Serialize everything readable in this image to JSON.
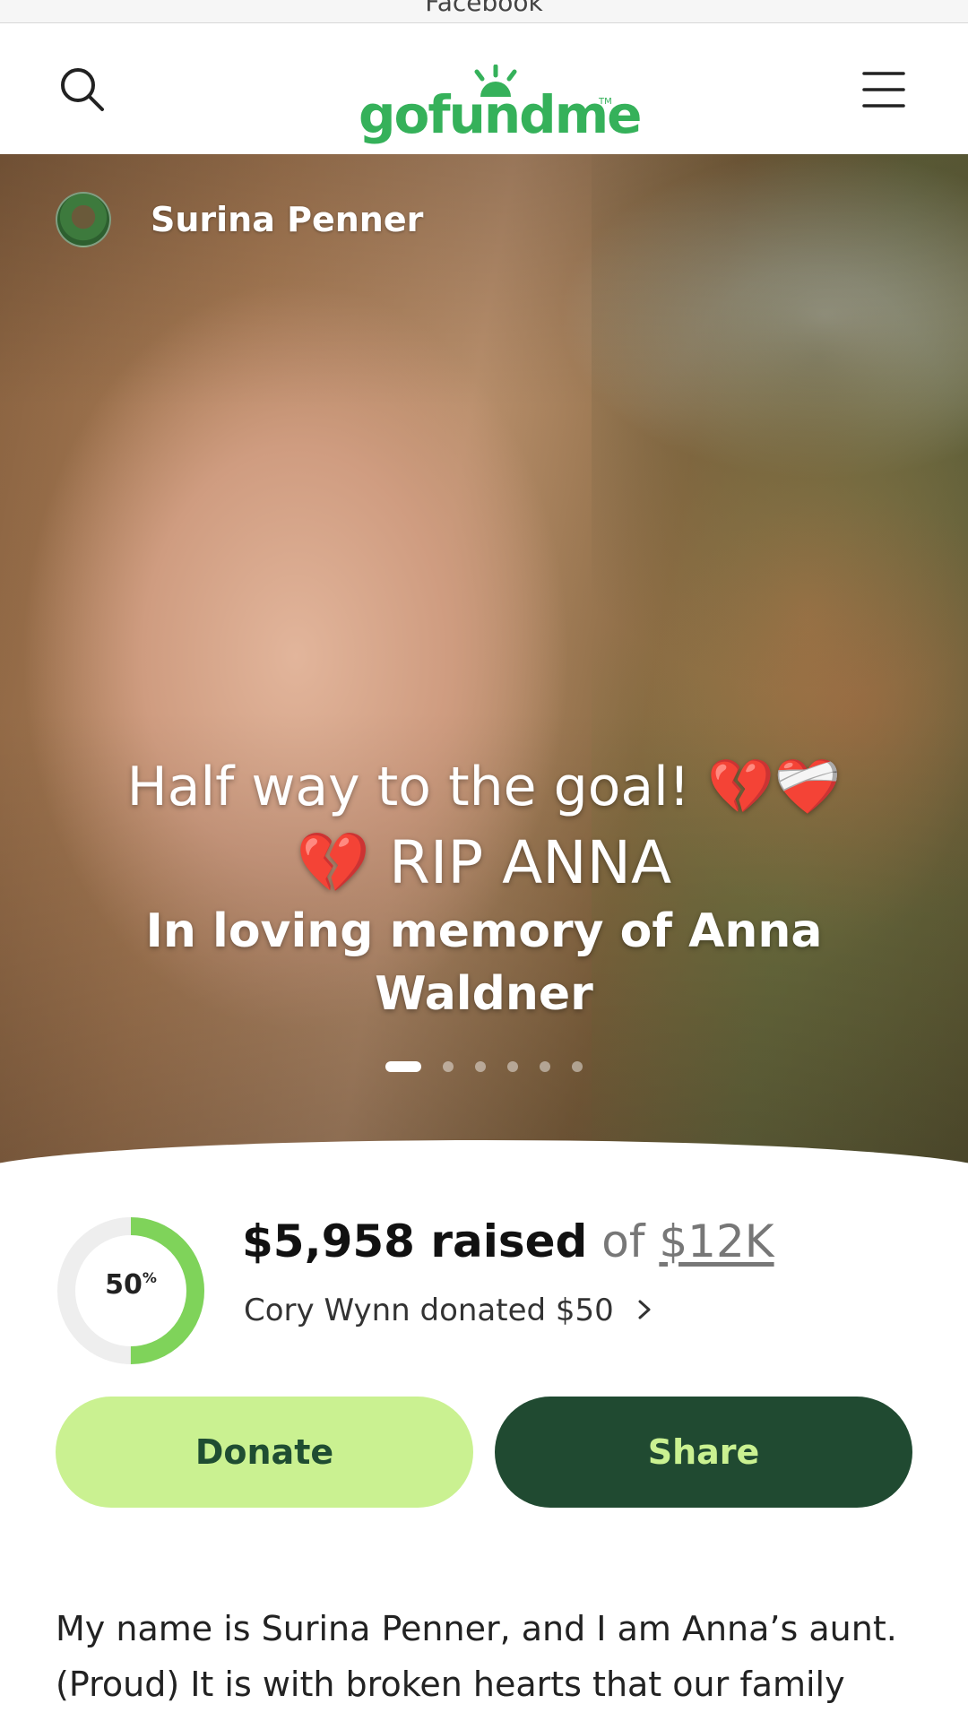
{
  "browser": {
    "title": "Facebook"
  },
  "header": {
    "logo_text": "gofundme",
    "logo_tm": "TM"
  },
  "organizer": {
    "name": "Surina Penner"
  },
  "hero_text": {
    "line1": "Half way to the goal! 💔❤️‍🩹",
    "line2": "💔 RIP ANNA",
    "line3": "In loving memory of Anna Waldner"
  },
  "carousel": {
    "slides": 6,
    "active_index": 0
  },
  "progress": {
    "percent": 50,
    "percent_label": "50",
    "percent_sign": "%"
  },
  "raised": {
    "amount": "$5,958 raised",
    "of": " of ",
    "goal": "$12K"
  },
  "recent_donation": "Cory Wynn donated $50",
  "buttons": {
    "donate": "Donate",
    "share": "Share"
  },
  "story": {
    "text": "My name is Surina Penner, and I am Anna’s aunt. (Proud) It is with broken hearts that our family"
  },
  "colors": {
    "brand_green": "#35b15a",
    "donate_bg": "#caf191",
    "share_bg": "#204a31",
    "progress_fill": "#7fd35a",
    "progress_track": "#eeeeee"
  },
  "icons": {
    "search": "search-icon",
    "menu": "hamburger-menu-icon",
    "chevron": "chevron-right-icon"
  }
}
